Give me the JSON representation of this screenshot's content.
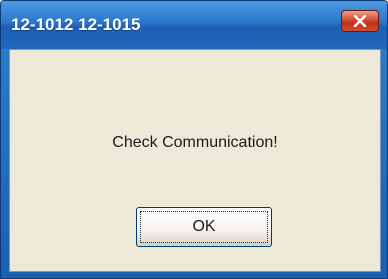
{
  "window": {
    "title": "12-1012 12-1015",
    "close_icon": "close-icon"
  },
  "dialog": {
    "message": "Check Communication!",
    "ok_label": "OK"
  },
  "colors": {
    "titlebar": "#2a76c9",
    "client_bg": "#ece9d8",
    "close_button": "#c0321a"
  }
}
